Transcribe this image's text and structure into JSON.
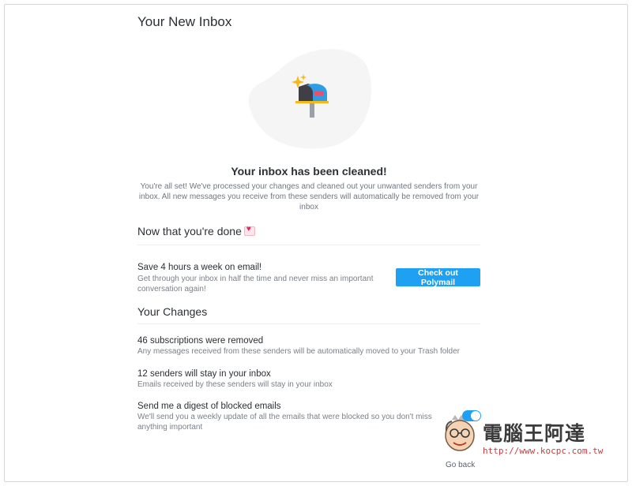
{
  "page": {
    "title": "Your New Inbox"
  },
  "status": {
    "heading": "Your inbox has been cleaned!",
    "description": "You're all set! We've processed your changes and cleaned out your unwanted senders from your inbox. All new messages you receive from these senders will automatically be removed from your inbox"
  },
  "done_section": {
    "heading": "Now that you're done",
    "promo": {
      "title": "Save 4 hours a week on email!",
      "description": "Get through your inbox in half the time and never miss an important conversation again!",
      "button_label": "Check out Polymail"
    }
  },
  "changes_section": {
    "heading": "Your Changes",
    "items": [
      {
        "title": "46 subscriptions were removed",
        "description": "Any messages received from these senders will be automatically moved to your Trash folder"
      },
      {
        "title": "12 senders will stay in your inbox",
        "description": "Emails received by these senders will stay in your inbox"
      },
      {
        "title": "Send me a digest of blocked emails",
        "description": "We'll send you a weekly update of all the emails that were blocked so you don't miss anything important",
        "toggle_on": true
      }
    ]
  },
  "footer": {
    "go_back": "Go back"
  },
  "watermark": {
    "title": "電腦王阿達",
    "url": "http://www.kocpc.com.tw"
  },
  "colors": {
    "accent": "#1ea1f2",
    "text": "#2b2f36",
    "muted": "#7a818b"
  }
}
